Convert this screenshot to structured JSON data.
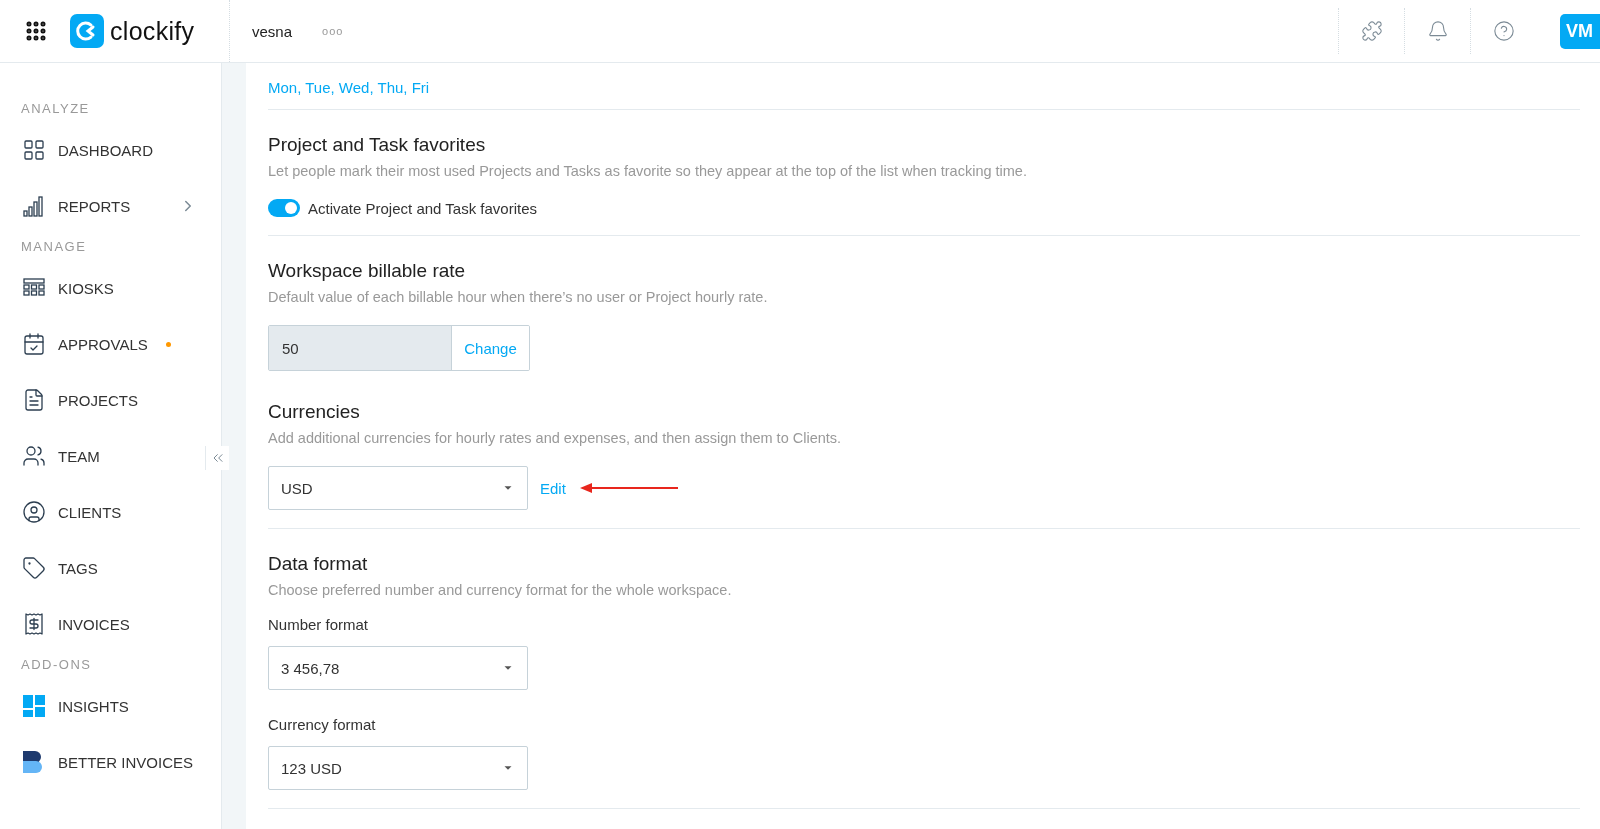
{
  "header": {
    "logo": "clockify",
    "workspace": "vesna",
    "more": "ooo",
    "avatar": "VM"
  },
  "sidebar": {
    "sections": [
      {
        "title": "ANALYZE",
        "items": [
          {
            "label": "DASHBOARD",
            "kind": "dashboard",
            "submenu": false,
            "notification": false
          },
          {
            "label": "REPORTS",
            "kind": "reports",
            "submenu": true,
            "notification": false
          }
        ]
      },
      {
        "title": "MANAGE",
        "items": [
          {
            "label": "KIOSKS",
            "kind": "kiosks",
            "submenu": false,
            "notification": false
          },
          {
            "label": "APPROVALS",
            "kind": "approvals",
            "submenu": false,
            "notification": true
          },
          {
            "label": "PROJECTS",
            "kind": "projects",
            "submenu": false,
            "notification": false
          },
          {
            "label": "TEAM",
            "kind": "team",
            "submenu": false,
            "notification": false
          },
          {
            "label": "CLIENTS",
            "kind": "clients",
            "submenu": false,
            "notification": false
          },
          {
            "label": "TAGS",
            "kind": "tags",
            "submenu": false,
            "notification": false
          },
          {
            "label": "INVOICES",
            "kind": "invoices",
            "submenu": false,
            "notification": false
          }
        ]
      },
      {
        "title": "ADD-ONS",
        "items": [
          {
            "label": "INSIGHTS",
            "kind": "insights",
            "submenu": false,
            "notification": false
          },
          {
            "label": "BETTER INVOICES",
            "kind": "better_invoices",
            "submenu": false,
            "notification": false
          }
        ]
      }
    ]
  },
  "content": {
    "workdays": "Mon, Tue, Wed, Thu, Fri",
    "favorites": {
      "title": "Project and Task favorites",
      "description": "Let people mark their most used Projects and Tasks as favorite so they appear at the top of the list when tracking time.",
      "toggle": {
        "label": "Activate Project and Task favorites",
        "on": true
      }
    },
    "billable_rate": {
      "title": "Workspace billable rate",
      "description": "Default value of each billable hour when there’s no user or Project hourly rate.",
      "value": "50",
      "button": "Change"
    },
    "currencies": {
      "title": "Currencies",
      "description": "Add additional currencies for hourly rates and expenses, and then assign them to Clients.",
      "value": "USD",
      "link": "Edit"
    },
    "data_format": {
      "title": "Data format",
      "description": "Choose preferred number and currency format for the whole workspace.",
      "number_label": "Number format",
      "number_value": "3 456,78",
      "currency_label": "Currency format",
      "currency_value": "123 USD"
    }
  }
}
